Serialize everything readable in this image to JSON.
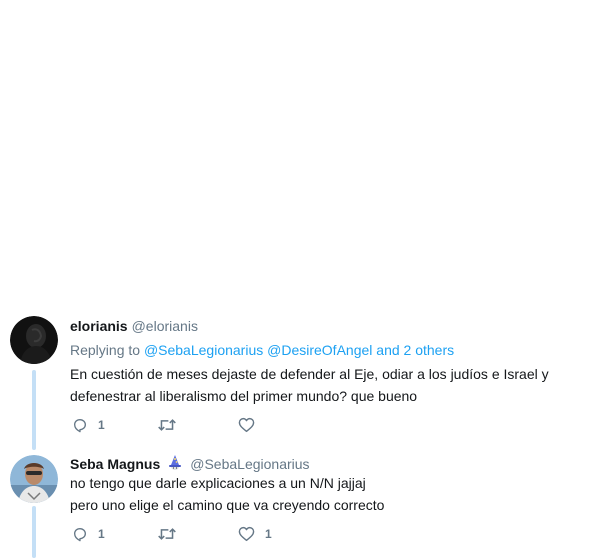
{
  "tweets": [
    {
      "name": "elorianis",
      "handle": "@elorianis",
      "replying_prefix": "Replying to",
      "replying_users": [
        "@SebaLegionarius",
        "@DesireOfAngel"
      ],
      "replying_suffix": "and 2 others",
      "text": "En cuestión de meses dejaste de defender al Eje, odiar a los judíos e Israel y\ndefenestrar al liberalismo del primer mundo? que bueno",
      "reply_count": "1",
      "retweet_count": "",
      "like_count": "",
      "icons": [
        "reply-icon",
        "retweet-icon",
        "like-icon"
      ]
    },
    {
      "name": "Seba Magnus",
      "handle": "@SebaLegionarius",
      "badge_icon": "wizard-emoji-icon",
      "text": "no tengo que darle explicaciones a un N/N jajjaj\npero uno elige el camino que va creyendo correcto",
      "reply_count": "1",
      "retweet_count": "",
      "like_count": "1",
      "icons": [
        "reply-icon",
        "retweet-icon",
        "like-icon"
      ]
    }
  ],
  "colors": {
    "link": "#1da1f2",
    "muted": "#657786",
    "thread_line": "#c4dff6"
  }
}
